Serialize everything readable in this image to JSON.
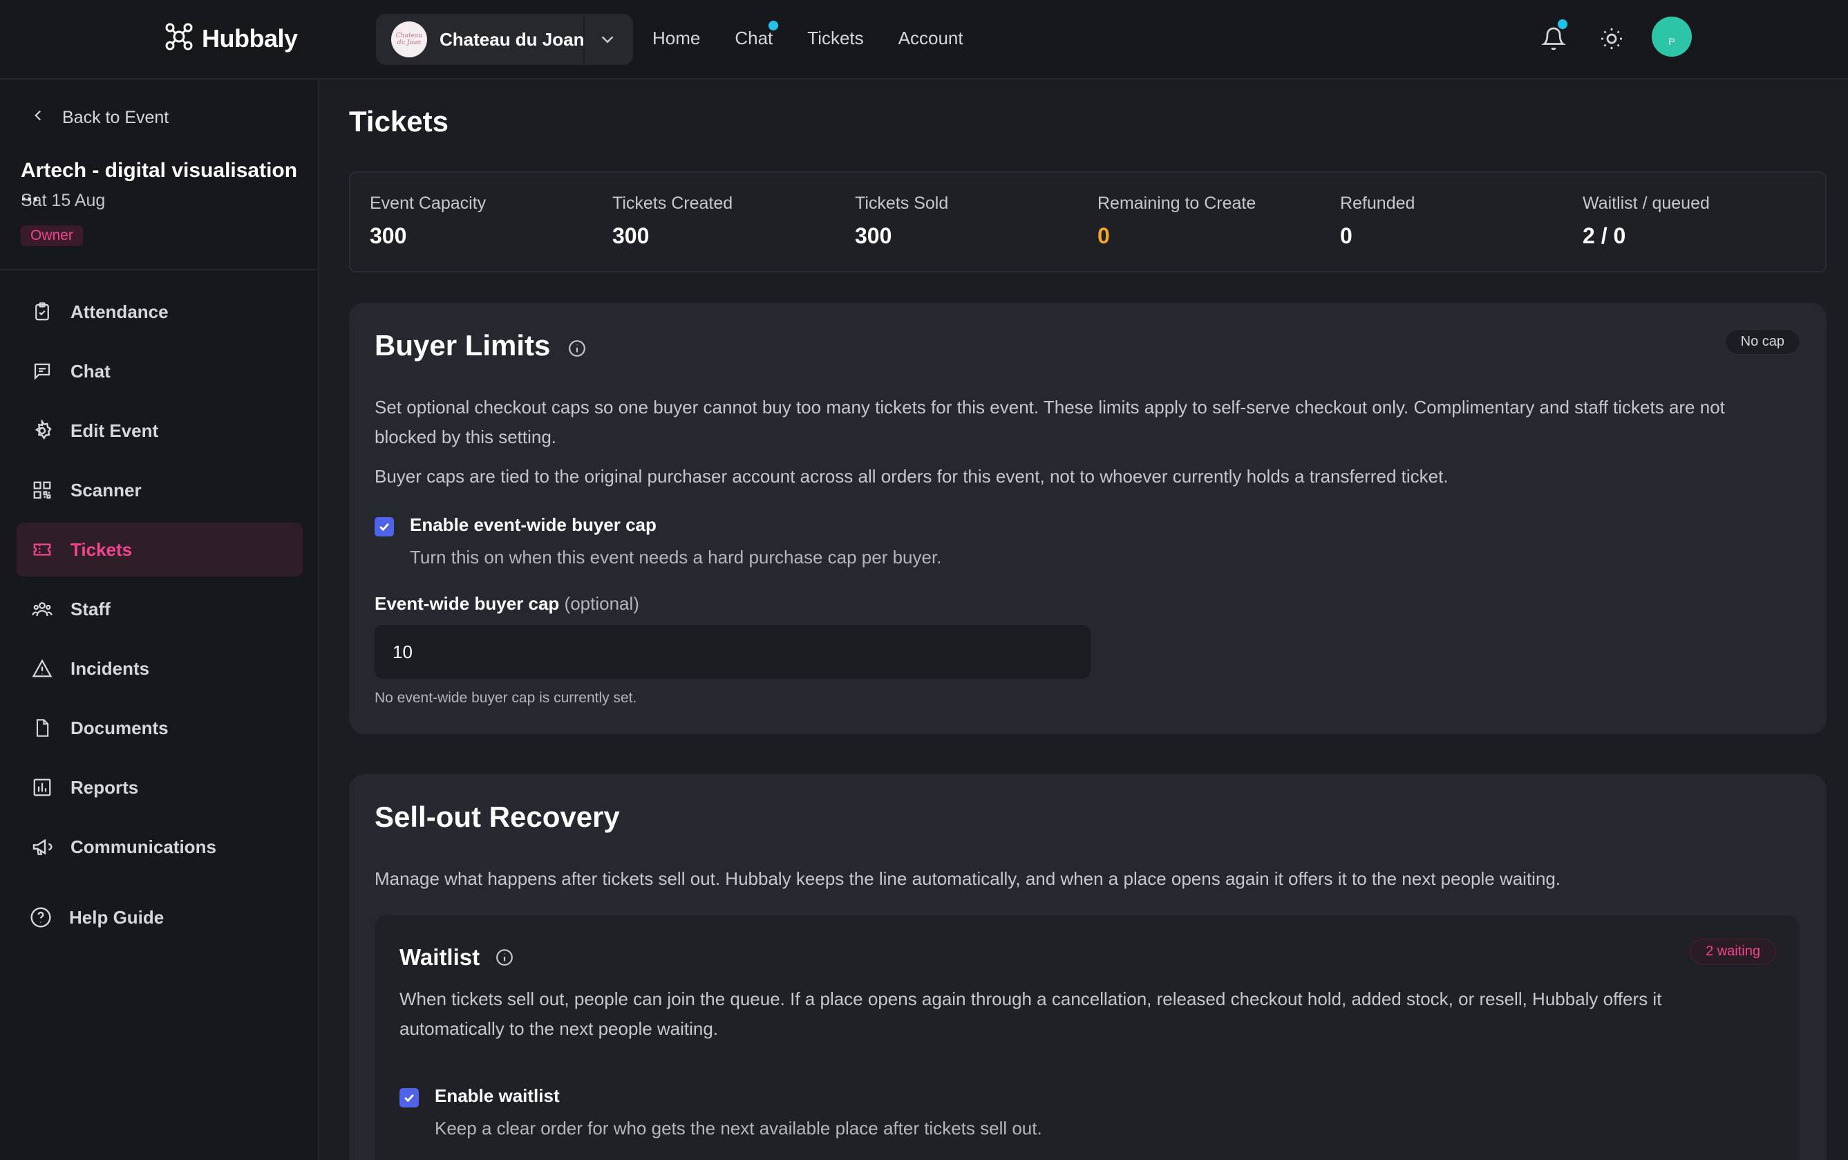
{
  "app": {
    "name": "Hubbaly"
  },
  "org": {
    "name": "Chateau du Joan",
    "avatar_text": "Chateau du Joan"
  },
  "topnav": [
    {
      "label": "Home"
    },
    {
      "label": "Chat"
    },
    {
      "label": "Tickets"
    },
    {
      "label": "Account"
    }
  ],
  "user": {
    "initial": "P"
  },
  "colors": {
    "accent": "#f0468e",
    "badge": "#22c3e8",
    "checkbox": "#4f63e8",
    "warn": "#f5a524",
    "avatar": "#2cc5a8"
  },
  "sidebar": {
    "back_label": "Back to Event",
    "event_title": "Artech - digital visualisation ...",
    "event_date": "Sat 15 Aug",
    "role": "Owner",
    "items": [
      {
        "label": "Attendance",
        "icon": "clipboard-check-icon"
      },
      {
        "label": "Chat",
        "icon": "message-square-icon"
      },
      {
        "label": "Edit Event",
        "icon": "gear-icon"
      },
      {
        "label": "Scanner",
        "icon": "qr-code-icon"
      },
      {
        "label": "Tickets",
        "icon": "ticket-icon"
      },
      {
        "label": "Staff",
        "icon": "users-icon"
      },
      {
        "label": "Incidents",
        "icon": "alert-triangle-icon"
      },
      {
        "label": "Documents",
        "icon": "file-icon"
      },
      {
        "label": "Reports",
        "icon": "bar-chart-icon"
      },
      {
        "label": "Communications",
        "icon": "megaphone-icon"
      }
    ],
    "help": {
      "label": "Help Guide",
      "icon": "help-circle-icon"
    }
  },
  "page": {
    "title": "Tickets"
  },
  "stats": [
    {
      "label": "Event Capacity",
      "value": "300"
    },
    {
      "label": "Tickets Created",
      "value": "300"
    },
    {
      "label": "Tickets Sold",
      "value": "300"
    },
    {
      "label": "Remaining to Create",
      "value": "0"
    },
    {
      "label": "Refunded",
      "value": "0"
    },
    {
      "label": "Waitlist / queued",
      "value": "2 / 0"
    }
  ],
  "buyer_limits": {
    "title": "Buyer Limits",
    "chip": "No cap",
    "desc1_line1": "Set optional checkout caps so one buyer cannot buy too many tickets for this event. These limits apply to self-serve checkout only. Complimentary and staff tickets are not",
    "desc1_line2": "blocked by this setting.",
    "desc2": "Buyer caps are tied to the original purchaser account across all orders for this event, not to whoever currently holds a transferred ticket.",
    "checkbox_label": "Enable event-wide buyer cap",
    "checkbox_help": "Turn this on when this event needs a hard purchase cap per buyer.",
    "field_label": "Event-wide buyer cap",
    "field_optional": "(optional)",
    "field_value": "10",
    "field_note": "No event-wide buyer cap is currently set."
  },
  "sellout": {
    "title": "Sell-out Recovery",
    "desc": "Manage what happens after tickets sell out. Hubbaly keeps the line automatically, and when a place opens again it offers it to the next people waiting.",
    "waitlist": {
      "title": "Waitlist",
      "chip": "2 waiting",
      "desc_line1": "When tickets sell out, people can join the queue. If a place opens again through a cancellation, released checkout hold, added stock, or resell, Hubbaly offers it",
      "desc_line2": "automatically to the next people waiting.",
      "checkbox_label": "Enable waitlist",
      "checkbox_help": "Keep a clear order for who gets the next available place after tickets sell out."
    }
  }
}
